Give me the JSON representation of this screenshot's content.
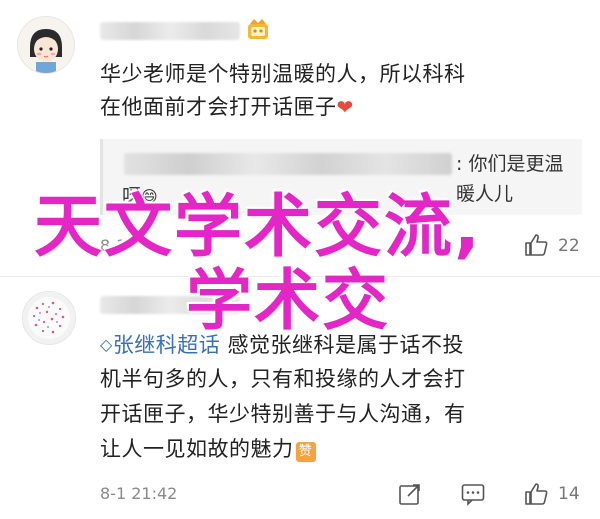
{
  "comment1": {
    "author_blurred": "██████",
    "text_line1": "华少老师是个特别温暖的人，所以科科",
    "text_line2": "在他面前才会打开话匣子",
    "quote": {
      "author_blurred": "████████████████",
      "text_part1": ": 你们是更温暖人儿",
      "text_part2": "呀"
    },
    "time": "8-1",
    "likes": "22"
  },
  "comment2": {
    "author_blurred": "██████",
    "topic_tag": "张继科超话",
    "text_line1_rest": "感觉张继科是属于话不投",
    "text_line2": "机半句多的人，只有和投缘的人才会打",
    "text_line3": "开话匣子，华少特别善于与人沟通，有",
    "text_line4": "让人一见如故的魅力",
    "time": "8-1 21:42",
    "likes": "14"
  },
  "overlay": {
    "line1": "天文学术交流,",
    "line2": "学术交"
  },
  "colors": {
    "overlay": "#e526c6",
    "topic": "#3b6fb6",
    "heart": "#e84a3c"
  }
}
